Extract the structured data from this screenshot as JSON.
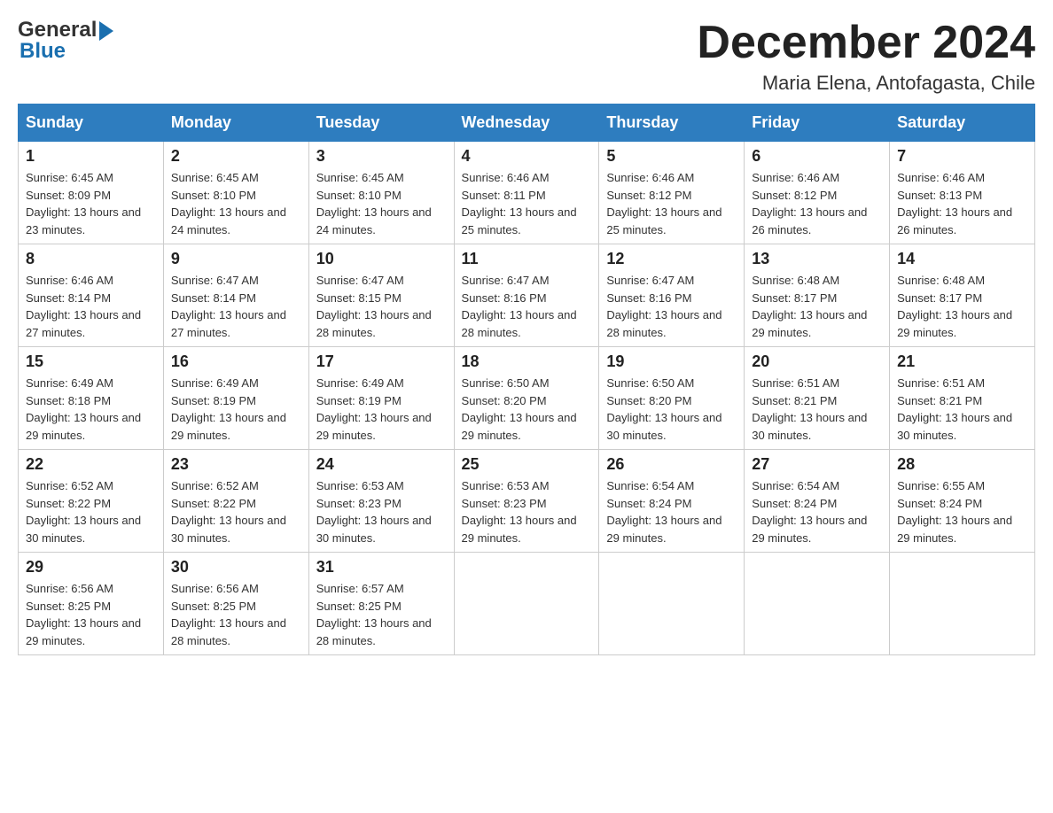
{
  "logo": {
    "text_general": "General",
    "arrow_symbol": "▶",
    "text_blue": "Blue"
  },
  "title": "December 2024",
  "location": "Maria Elena, Antofagasta, Chile",
  "days_of_week": [
    "Sunday",
    "Monday",
    "Tuesday",
    "Wednesday",
    "Thursday",
    "Friday",
    "Saturday"
  ],
  "weeks": [
    [
      {
        "day": "1",
        "sunrise": "6:45 AM",
        "sunset": "8:09 PM",
        "daylight": "13 hours and 23 minutes."
      },
      {
        "day": "2",
        "sunrise": "6:45 AM",
        "sunset": "8:10 PM",
        "daylight": "13 hours and 24 minutes."
      },
      {
        "day": "3",
        "sunrise": "6:45 AM",
        "sunset": "8:10 PM",
        "daylight": "13 hours and 24 minutes."
      },
      {
        "day": "4",
        "sunrise": "6:46 AM",
        "sunset": "8:11 PM",
        "daylight": "13 hours and 25 minutes."
      },
      {
        "day": "5",
        "sunrise": "6:46 AM",
        "sunset": "8:12 PM",
        "daylight": "13 hours and 25 minutes."
      },
      {
        "day": "6",
        "sunrise": "6:46 AM",
        "sunset": "8:12 PM",
        "daylight": "13 hours and 26 minutes."
      },
      {
        "day": "7",
        "sunrise": "6:46 AM",
        "sunset": "8:13 PM",
        "daylight": "13 hours and 26 minutes."
      }
    ],
    [
      {
        "day": "8",
        "sunrise": "6:46 AM",
        "sunset": "8:14 PM",
        "daylight": "13 hours and 27 minutes."
      },
      {
        "day": "9",
        "sunrise": "6:47 AM",
        "sunset": "8:14 PM",
        "daylight": "13 hours and 27 minutes."
      },
      {
        "day": "10",
        "sunrise": "6:47 AM",
        "sunset": "8:15 PM",
        "daylight": "13 hours and 28 minutes."
      },
      {
        "day": "11",
        "sunrise": "6:47 AM",
        "sunset": "8:16 PM",
        "daylight": "13 hours and 28 minutes."
      },
      {
        "day": "12",
        "sunrise": "6:47 AM",
        "sunset": "8:16 PM",
        "daylight": "13 hours and 28 minutes."
      },
      {
        "day": "13",
        "sunrise": "6:48 AM",
        "sunset": "8:17 PM",
        "daylight": "13 hours and 29 minutes."
      },
      {
        "day": "14",
        "sunrise": "6:48 AM",
        "sunset": "8:17 PM",
        "daylight": "13 hours and 29 minutes."
      }
    ],
    [
      {
        "day": "15",
        "sunrise": "6:49 AM",
        "sunset": "8:18 PM",
        "daylight": "13 hours and 29 minutes."
      },
      {
        "day": "16",
        "sunrise": "6:49 AM",
        "sunset": "8:19 PM",
        "daylight": "13 hours and 29 minutes."
      },
      {
        "day": "17",
        "sunrise": "6:49 AM",
        "sunset": "8:19 PM",
        "daylight": "13 hours and 29 minutes."
      },
      {
        "day": "18",
        "sunrise": "6:50 AM",
        "sunset": "8:20 PM",
        "daylight": "13 hours and 29 minutes."
      },
      {
        "day": "19",
        "sunrise": "6:50 AM",
        "sunset": "8:20 PM",
        "daylight": "13 hours and 30 minutes."
      },
      {
        "day": "20",
        "sunrise": "6:51 AM",
        "sunset": "8:21 PM",
        "daylight": "13 hours and 30 minutes."
      },
      {
        "day": "21",
        "sunrise": "6:51 AM",
        "sunset": "8:21 PM",
        "daylight": "13 hours and 30 minutes."
      }
    ],
    [
      {
        "day": "22",
        "sunrise": "6:52 AM",
        "sunset": "8:22 PM",
        "daylight": "13 hours and 30 minutes."
      },
      {
        "day": "23",
        "sunrise": "6:52 AM",
        "sunset": "8:22 PM",
        "daylight": "13 hours and 30 minutes."
      },
      {
        "day": "24",
        "sunrise": "6:53 AM",
        "sunset": "8:23 PM",
        "daylight": "13 hours and 30 minutes."
      },
      {
        "day": "25",
        "sunrise": "6:53 AM",
        "sunset": "8:23 PM",
        "daylight": "13 hours and 29 minutes."
      },
      {
        "day": "26",
        "sunrise": "6:54 AM",
        "sunset": "8:24 PM",
        "daylight": "13 hours and 29 minutes."
      },
      {
        "day": "27",
        "sunrise": "6:54 AM",
        "sunset": "8:24 PM",
        "daylight": "13 hours and 29 minutes."
      },
      {
        "day": "28",
        "sunrise": "6:55 AM",
        "sunset": "8:24 PM",
        "daylight": "13 hours and 29 minutes."
      }
    ],
    [
      {
        "day": "29",
        "sunrise": "6:56 AM",
        "sunset": "8:25 PM",
        "daylight": "13 hours and 29 minutes."
      },
      {
        "day": "30",
        "sunrise": "6:56 AM",
        "sunset": "8:25 PM",
        "daylight": "13 hours and 28 minutes."
      },
      {
        "day": "31",
        "sunrise": "6:57 AM",
        "sunset": "8:25 PM",
        "daylight": "13 hours and 28 minutes."
      },
      null,
      null,
      null,
      null
    ]
  ]
}
